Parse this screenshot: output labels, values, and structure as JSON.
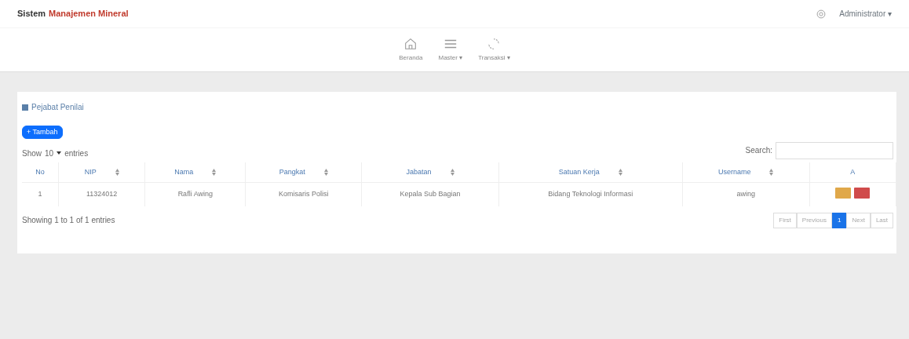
{
  "brand": {
    "first": "Sistem",
    "rest": "Manajemen Mineral"
  },
  "user": {
    "label": "Administrator",
    "caret": "▾"
  },
  "nav": [
    {
      "label": "Beranda",
      "kind": "home"
    },
    {
      "label": "Master",
      "kind": "menu",
      "caret": "▾"
    },
    {
      "label": "Transaksi",
      "kind": "cycle",
      "caret": "▾"
    }
  ],
  "panel": {
    "title": "Pejabat Penilai",
    "add_button": "+ Tambah"
  },
  "length": {
    "show": "Show",
    "value": "10",
    "entries": "entries"
  },
  "search": {
    "label": "Search:"
  },
  "table": {
    "columns": [
      {
        "label": "No",
        "sortable": false
      },
      {
        "label": "NIP",
        "sortable": true
      },
      {
        "label": "Nama",
        "sortable": true
      },
      {
        "label": "Pangkat",
        "sortable": true
      },
      {
        "label": "Jabatan",
        "sortable": true
      },
      {
        "label": "Satuan Kerja",
        "sortable": true
      },
      {
        "label": "Username",
        "sortable": true
      },
      {
        "label": "A",
        "sortable": false
      }
    ],
    "rows": [
      {
        "cells": [
          "1",
          "11324012",
          "Rafli Awing",
          "Komisaris Polisi",
          "Kepala Sub Bagian",
          "Bidang Teknologi Informasi",
          "awing"
        ]
      }
    ]
  },
  "info": "Showing 1 to 1 of 1 entries",
  "pagination": [
    {
      "label": "First",
      "selected": false
    },
    {
      "label": "Previous",
      "selected": false
    },
    {
      "label": "1",
      "selected": true
    },
    {
      "label": "Next",
      "selected": false
    },
    {
      "label": "Last",
      "selected": false
    }
  ]
}
